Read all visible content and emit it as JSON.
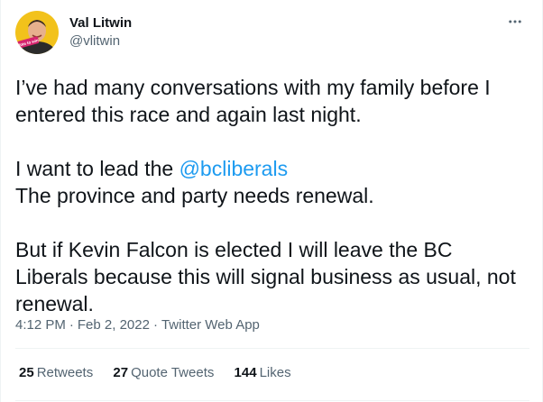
{
  "author": {
    "display_name": "Val Litwin",
    "handle": "@vlitwin",
    "avatar_badge_text": "Vote to win"
  },
  "tweet": {
    "line1": "I’ve had many conversations with my family before I",
    "line2": "entered this race and again last night.",
    "p2_prefix": "I want to lead the ",
    "p2_mention": "@bcliberals",
    "p2_line2": "The province and party needs renewal.",
    "p3_line1": "But if Kevin Falcon is elected I will leave the BC",
    "p3_line2": "Liberals because this will signal business as usual, not",
    "p3_line3": "renewal."
  },
  "meta": {
    "time": "4:12 PM",
    "separator": "·",
    "date": "Feb 2, 2022",
    "source": "Twitter Web App"
  },
  "stats": {
    "retweets_count": "25",
    "retweets_label": "Retweets",
    "quotes_count": "27",
    "quotes_label": "Quote Tweets",
    "likes_count": "144",
    "likes_label": "Likes"
  },
  "colors": {
    "accent": "#1d9bf0",
    "text": "#0f1419",
    "secondary": "#536471",
    "avatar_bg": "#f2c21b"
  },
  "icons": {
    "more": "more-horizontal-icon"
  }
}
